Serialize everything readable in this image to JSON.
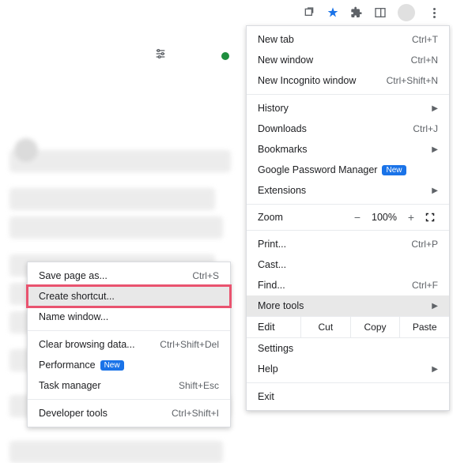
{
  "toolbar": {
    "icons": {
      "share": "share-icon",
      "star": "star-icon",
      "ext": "puzzle-icon",
      "panel": "panel-icon",
      "avatar": "avatar",
      "menu": "more-icon"
    }
  },
  "menu": {
    "new_tab": {
      "label": "New tab",
      "shortcut": "Ctrl+T"
    },
    "new_window": {
      "label": "New window",
      "shortcut": "Ctrl+N"
    },
    "new_incognito": {
      "label": "New Incognito window",
      "shortcut": "Ctrl+Shift+N"
    },
    "history": {
      "label": "History"
    },
    "downloads": {
      "label": "Downloads",
      "shortcut": "Ctrl+J"
    },
    "bookmarks": {
      "label": "Bookmarks"
    },
    "password_mgr": {
      "label": "Google Password Manager",
      "badge": "New"
    },
    "extensions": {
      "label": "Extensions"
    },
    "zoom": {
      "label": "Zoom",
      "minus": "−",
      "value": "100%",
      "plus": "+"
    },
    "print": {
      "label": "Print...",
      "shortcut": "Ctrl+P"
    },
    "cast": {
      "label": "Cast..."
    },
    "find": {
      "label": "Find...",
      "shortcut": "Ctrl+F"
    },
    "more_tools": {
      "label": "More tools"
    },
    "edit": {
      "label": "Edit",
      "cut": "Cut",
      "copy": "Copy",
      "paste": "Paste"
    },
    "settings": {
      "label": "Settings"
    },
    "help": {
      "label": "Help"
    },
    "exit": {
      "label": "Exit"
    }
  },
  "submenu": {
    "save_page": {
      "label": "Save page as...",
      "shortcut": "Ctrl+S"
    },
    "create_shortcut": {
      "label": "Create shortcut..."
    },
    "name_window": {
      "label": "Name window..."
    },
    "clear_data": {
      "label": "Clear browsing data...",
      "shortcut": "Ctrl+Shift+Del"
    },
    "performance": {
      "label": "Performance",
      "badge": "New"
    },
    "task_manager": {
      "label": "Task manager",
      "shortcut": "Shift+Esc"
    },
    "dev_tools": {
      "label": "Developer tools",
      "shortcut": "Ctrl+Shift+I"
    }
  }
}
